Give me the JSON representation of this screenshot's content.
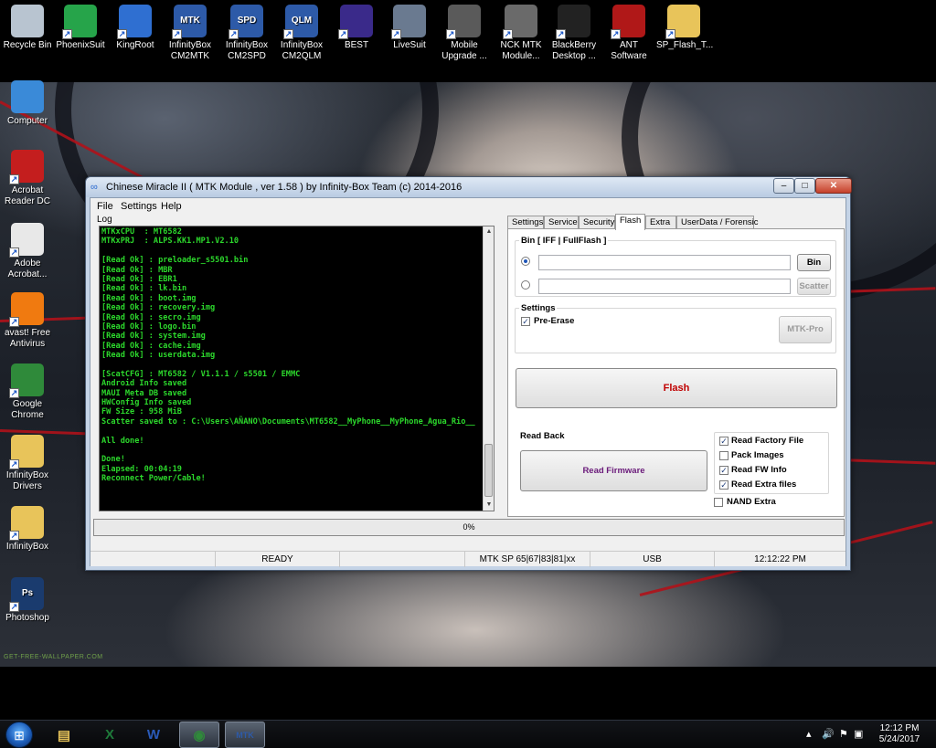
{
  "desktop": {
    "top_icons": [
      {
        "label": "Recycle Bin",
        "icon": "recycle-bin-icon",
        "color": "#b8c4d0"
      },
      {
        "label": "PhoenixSuit",
        "icon": "phoenixsuit-icon",
        "color": "#26a44a"
      },
      {
        "label": "KingRoot",
        "icon": "kingroot-icon",
        "color": "#2f6fd1"
      },
      {
        "label": "InfinityBox CM2MTK",
        "icon": "infinitybox-cm2mtk-icon",
        "color": "#2d5aa8",
        "glyph": "MTK"
      },
      {
        "label": "InfinityBox CM2SPD",
        "icon": "infinitybox-cm2spd-icon",
        "color": "#2d5aa8",
        "glyph": "SPD"
      },
      {
        "label": "InfinityBox CM2QLM",
        "icon": "infinitybox-cm2qlm-icon",
        "color": "#2d5aa8",
        "glyph": "QLM"
      },
      {
        "label": "BEST",
        "icon": "best-icon",
        "color": "#3a2a8a"
      },
      {
        "label": "LiveSuit",
        "icon": "livesuit-icon",
        "color": "#6a7a90"
      },
      {
        "label": "Mobile Upgrade ...",
        "icon": "gear-icon",
        "color": "#5a5a5a"
      },
      {
        "label": "NCK MTK Module...",
        "icon": "phone-icon",
        "color": "#6a6a6a"
      },
      {
        "label": "BlackBerry Desktop ...",
        "icon": "blackberry-icon",
        "color": "#222222"
      },
      {
        "label": "ANT Software",
        "icon": "ant-software-icon",
        "color": "#b01818"
      },
      {
        "label": "SP_Flash_T...",
        "icon": "folder-icon",
        "color": "#e8c45a"
      }
    ],
    "left_icons": [
      {
        "label": "Computer",
        "icon": "computer-icon",
        "color": "#3a8ad8"
      },
      {
        "label": "Acrobat Reader DC",
        "icon": "acrobat-reader-icon",
        "color": "#c41e1e"
      },
      {
        "label": "Adobe Acrobat...",
        "icon": "adobe-acrobat-icon",
        "color": "#e8e8e8"
      },
      {
        "label": "avast! Free Antivirus",
        "icon": "avast-icon",
        "color": "#f07a10"
      },
      {
        "label": "Google Chrome",
        "icon": "chrome-icon",
        "color": "#2f8a3a"
      },
      {
        "label": "InfinityBox Drivers",
        "icon": "folder-icon",
        "color": "#e8c45a"
      },
      {
        "label": "InfinityBox",
        "icon": "folder-icon",
        "color": "#e8c45a"
      },
      {
        "label": "Photoshop",
        "icon": "photoshop-icon",
        "color": "#1a3b6e",
        "glyph": "Ps"
      }
    ],
    "wallpaper_credit": "GET-FREE-WALLPAPER.COM"
  },
  "window": {
    "title": "Chinese Miracle II ( MTK Module , ver 1.58 ) by Infinity-Box Team (c) 2014-2016",
    "menu": [
      "File",
      "Settings",
      "Help"
    ],
    "log_label": "Log",
    "log_lines": [
      "MTKxCPU  : MT6582",
      "MTKxPRJ  : ALPS.KK1.MP1.V2.10",
      "",
      "[Read Ok] : preloader_s5501.bin",
      "[Read Ok] : MBR",
      "[Read Ok] : EBR1",
      "[Read Ok] : lk.bin",
      "[Read Ok] : boot.img",
      "[Read Ok] : recovery.img",
      "[Read Ok] : secro.img",
      "[Read Ok] : logo.bin",
      "[Read Ok] : system.img",
      "[Read Ok] : cache.img",
      "[Read Ok] : userdata.img",
      "",
      "[ScatCFG] : MT6582 / V1.1.1 / s5501 / EMMC",
      "Android Info saved",
      "MAUI Meta DB saved",
      "HWConfig Info saved",
      "FW Size : 958 MiB",
      "Scatter saved to : C:\\Users\\AÑANO\\Documents\\MT6582__MyPhone__MyPhone_Agua_Rio__",
      "",
      "All done!",
      "",
      "Done!",
      "Elapsed: 00:04:19",
      "Reconnect Power/Cable!"
    ],
    "tabs": [
      "Settings",
      "Service",
      "Security",
      "Flash",
      "Extra",
      "UserData / Forensic"
    ],
    "active_tab": "Flash",
    "flash": {
      "bin_group_title": "Bin  [ IFF | FullFlash ]",
      "bin_button": "Bin",
      "scatter_button": "Scatter",
      "bin_path_value": "",
      "scatter_path_value": "",
      "settings_group_title": "Settings",
      "pre_erase_label": "Pre-Erase",
      "pre_erase_checked": true,
      "mtk_pro_button": "MTK-Pro",
      "flash_button": "Flash",
      "read_back_title": "Read Back",
      "read_firmware_button": "Read Firmware",
      "options": [
        {
          "label": "Read Factory File",
          "checked": true
        },
        {
          "label": "Pack Images",
          "checked": false
        },
        {
          "label": "Read FW Info",
          "checked": true
        },
        {
          "label": "Read Extra files",
          "checked": true
        }
      ],
      "nand_extra_label": "NAND Extra",
      "nand_extra_checked": false
    },
    "progress_text": "0%",
    "progress_value": 0,
    "status": [
      "",
      "READY",
      "",
      "MTK SP 65|67|83|81|xx",
      "USB",
      "12:12:22 PM"
    ]
  },
  "taskbar": {
    "start_icon": "windows-start-icon",
    "pinned": [
      {
        "name": "explorer-icon",
        "glyph": "▤",
        "color": "#e8c45a"
      },
      {
        "name": "excel-icon",
        "glyph": "X",
        "color": "#1e7a3a"
      },
      {
        "name": "word-icon",
        "glyph": "W",
        "color": "#2a5ab8"
      },
      {
        "name": "chrome-icon",
        "glyph": "◉",
        "color": "#2f8a3a"
      },
      {
        "name": "cm2-mtk-icon",
        "glyph": "MTK",
        "color": "#2d5aa8"
      }
    ],
    "time": "12:12 PM",
    "date": "5/24/2017"
  }
}
